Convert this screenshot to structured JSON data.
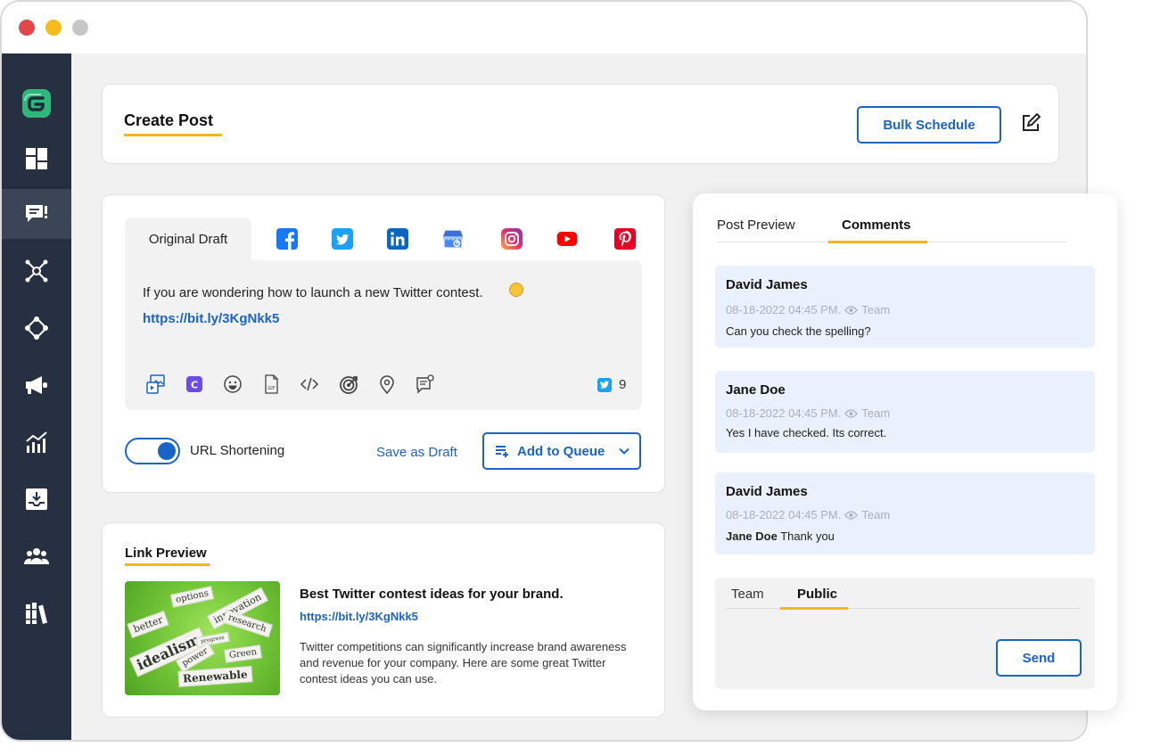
{
  "window": {
    "controls": [
      "close",
      "minimize",
      "maximize"
    ]
  },
  "sidebar": {
    "logo_icon": "brand-logo",
    "items": [
      {
        "icon": "dashboard-icon"
      },
      {
        "icon": "compose-icon",
        "active": true
      },
      {
        "icon": "network-icon"
      },
      {
        "icon": "integrations-icon"
      },
      {
        "icon": "megaphone-icon"
      },
      {
        "icon": "analytics-icon"
      },
      {
        "icon": "inbox-download-icon"
      },
      {
        "icon": "team-icon"
      },
      {
        "icon": "library-icon"
      }
    ]
  },
  "header": {
    "title": "Create Post",
    "bulk_schedule_label": "Bulk Schedule",
    "edit_icon": "edit-square-icon"
  },
  "composer": {
    "draft_tab_label": "Original Draft",
    "networks": [
      "facebook",
      "twitter",
      "linkedin",
      "google-business",
      "instagram",
      "youtube",
      "pinterest"
    ],
    "post_text": "If you are wondering how to launch a new Twitter contest.",
    "post_link": "https://bit.ly/3KgNkk5",
    "tools": [
      "media-icon",
      "canva-icon",
      "emoji-icon",
      "gif-icon",
      "code-icon",
      "target-icon",
      "location-icon",
      "poll-icon"
    ],
    "char_count": "9",
    "url_shortening_label": "URL Shortening",
    "url_shortening_on": true,
    "save_draft_label": "Save as Draft",
    "add_queue_label": "Add to Queue"
  },
  "link_preview": {
    "heading": "Link Preview",
    "image_words": [
      "options",
      "innovation",
      "better",
      "research",
      "idealism",
      "progress",
      "power",
      "Green",
      "Renewable"
    ],
    "title": "Best Twitter contest ideas for your brand.",
    "url": "https://bit.ly/3KgNkk5",
    "description": "Twitter competitions can significantly increase brand awareness and revenue for your company. Here are some great Twitter contest ideas you can use."
  },
  "comments_panel": {
    "tabs": [
      "Post Preview",
      "Comments"
    ],
    "active_tab": "Comments",
    "comments": [
      {
        "author": "David James",
        "timestamp": "08-18-2022 04:45 PM.",
        "visibility": "Team",
        "mention": "",
        "text": "Can you check the spelling?"
      },
      {
        "author": "Jane Doe",
        "timestamp": "08-18-2022 04:45 PM.",
        "visibility": "Team",
        "mention": "",
        "text": "Yes I have checked. Its correct."
      },
      {
        "author": "David James",
        "timestamp": "08-18-2022 04:45 PM.",
        "visibility": "Team",
        "mention": "Jane Doe",
        "text": "Thank you"
      }
    ],
    "reply_tabs": [
      "Team",
      "Public"
    ],
    "active_reply_tab": "Public",
    "send_label": "Send"
  },
  "colors": {
    "accent_blue": "#1a63c7",
    "underline_yellow": "#f6b51e",
    "sidebar_bg": "#263040",
    "comment_bg": "#eaf1fd",
    "brand_green": "#2fb67c"
  }
}
